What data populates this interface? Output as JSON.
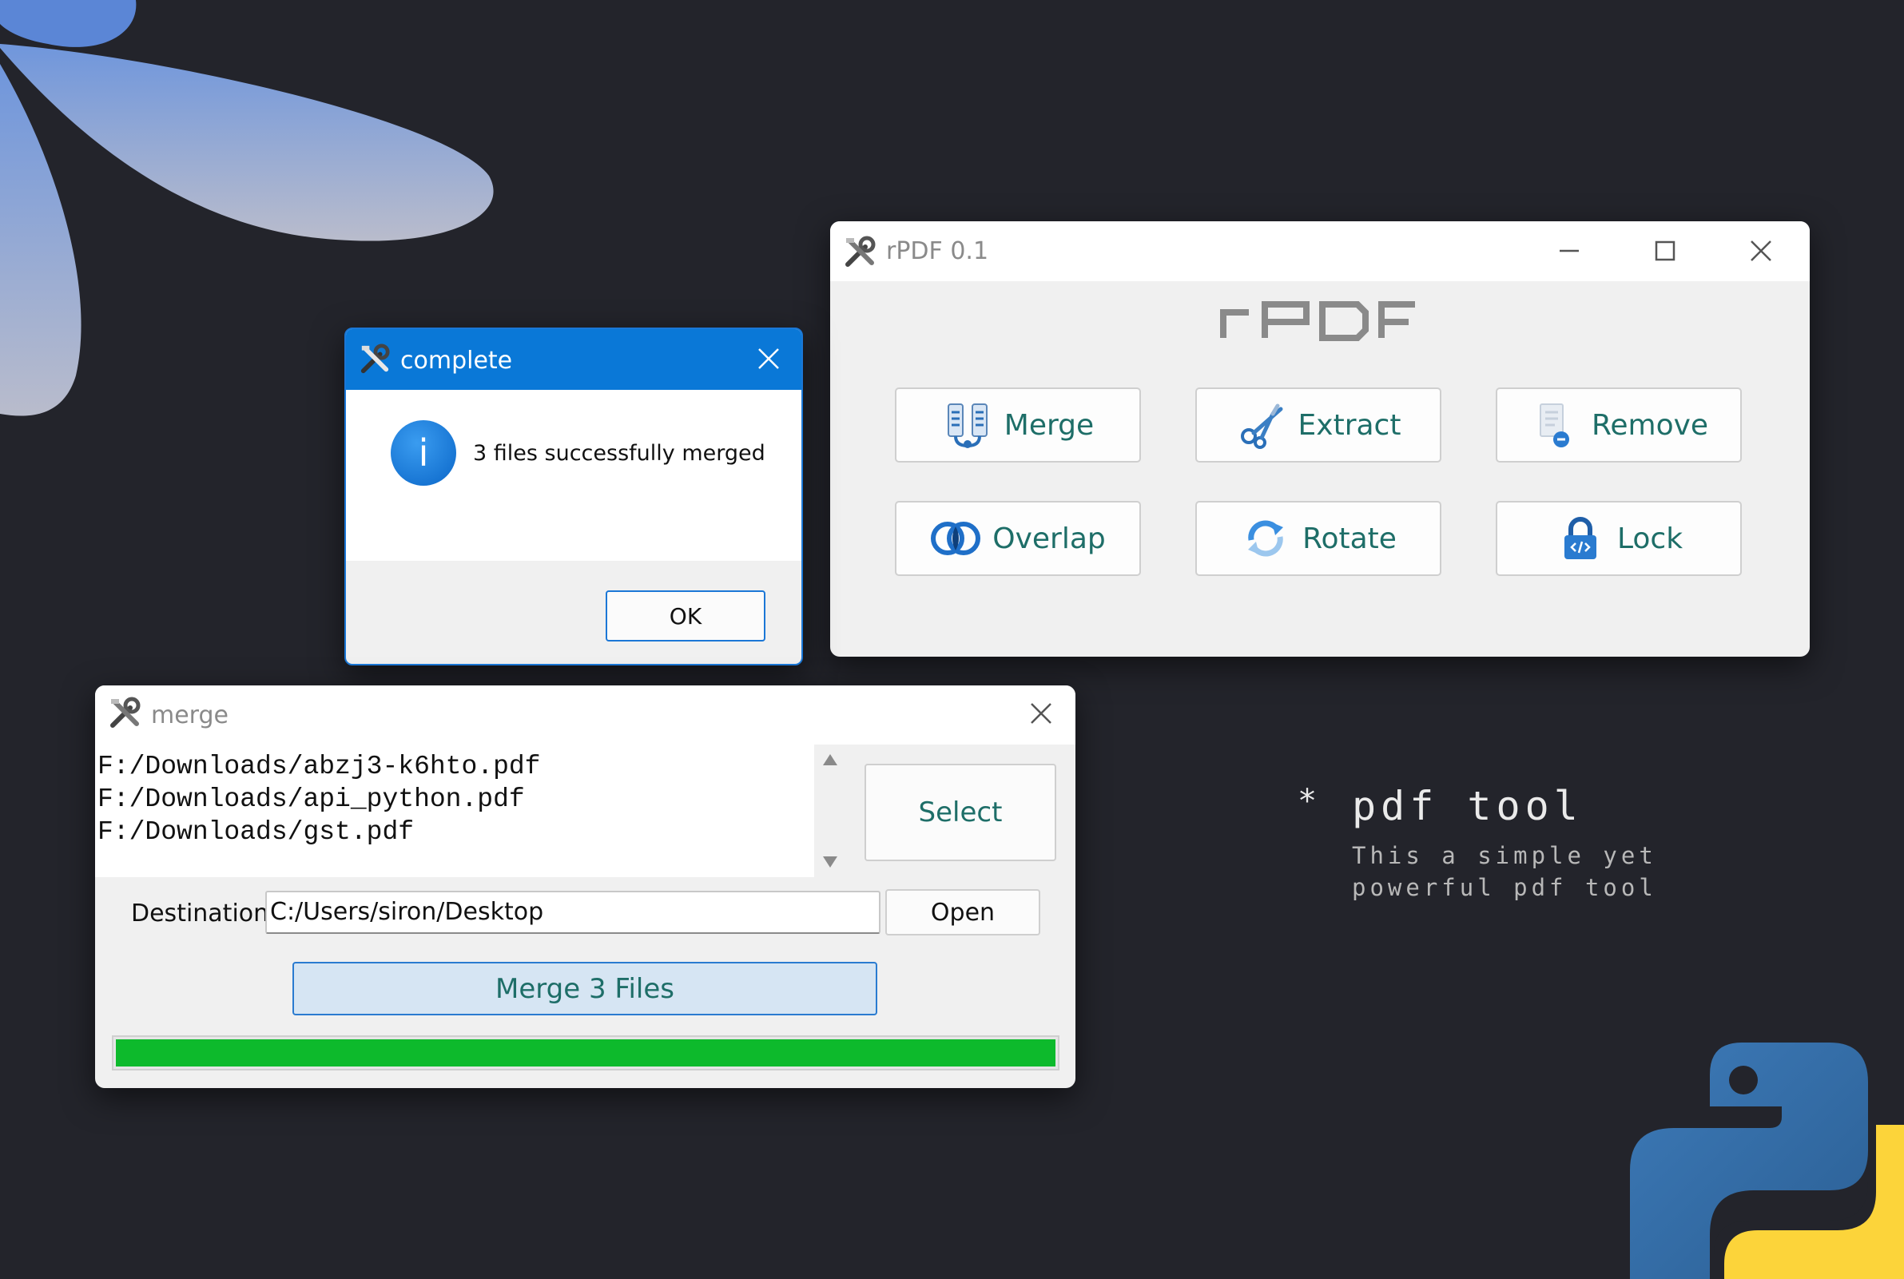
{
  "colors": {
    "background": "#23242b",
    "accent_blue": "#0a78d7",
    "teal_text": "#1e6e68",
    "progress_green": "#0dba2c",
    "python_blue": "#2f6ea8",
    "python_yellow": "#fcd43a"
  },
  "main_window": {
    "title": "rPDF 0.1",
    "logo_text": "rPDF",
    "buttons": [
      {
        "label": "Merge",
        "icon": "merge-icon"
      },
      {
        "label": "Extract",
        "icon": "scissors-icon"
      },
      {
        "label": "Remove",
        "icon": "remove-page-icon"
      },
      {
        "label": "Overlap",
        "icon": "overlap-rings-icon"
      },
      {
        "label": "Rotate",
        "icon": "rotate-icon"
      },
      {
        "label": "Lock",
        "icon": "padlock-icon"
      }
    ]
  },
  "complete_dialog": {
    "title": "complete",
    "message": "3 files successfully merged",
    "ok_label": "OK",
    "info_glyph": "i"
  },
  "merge_window": {
    "title": "merge",
    "files": [
      "F:/Downloads/abzj3-k6hto.pdf",
      "F:/Downloads/api_python.pdf",
      "F:/Downloads/gst.pdf"
    ],
    "select_label": "Select",
    "destination_label": "Destination",
    "destination_value": "C:/Users/siron/Desktop",
    "open_label": "Open",
    "merge_label": "Merge 3 Files",
    "progress": 1.0
  },
  "side_text": {
    "bullet": "*",
    "heading": "pdf tool",
    "line1": "This a simple yet",
    "line2": "powerful pdf tool"
  }
}
